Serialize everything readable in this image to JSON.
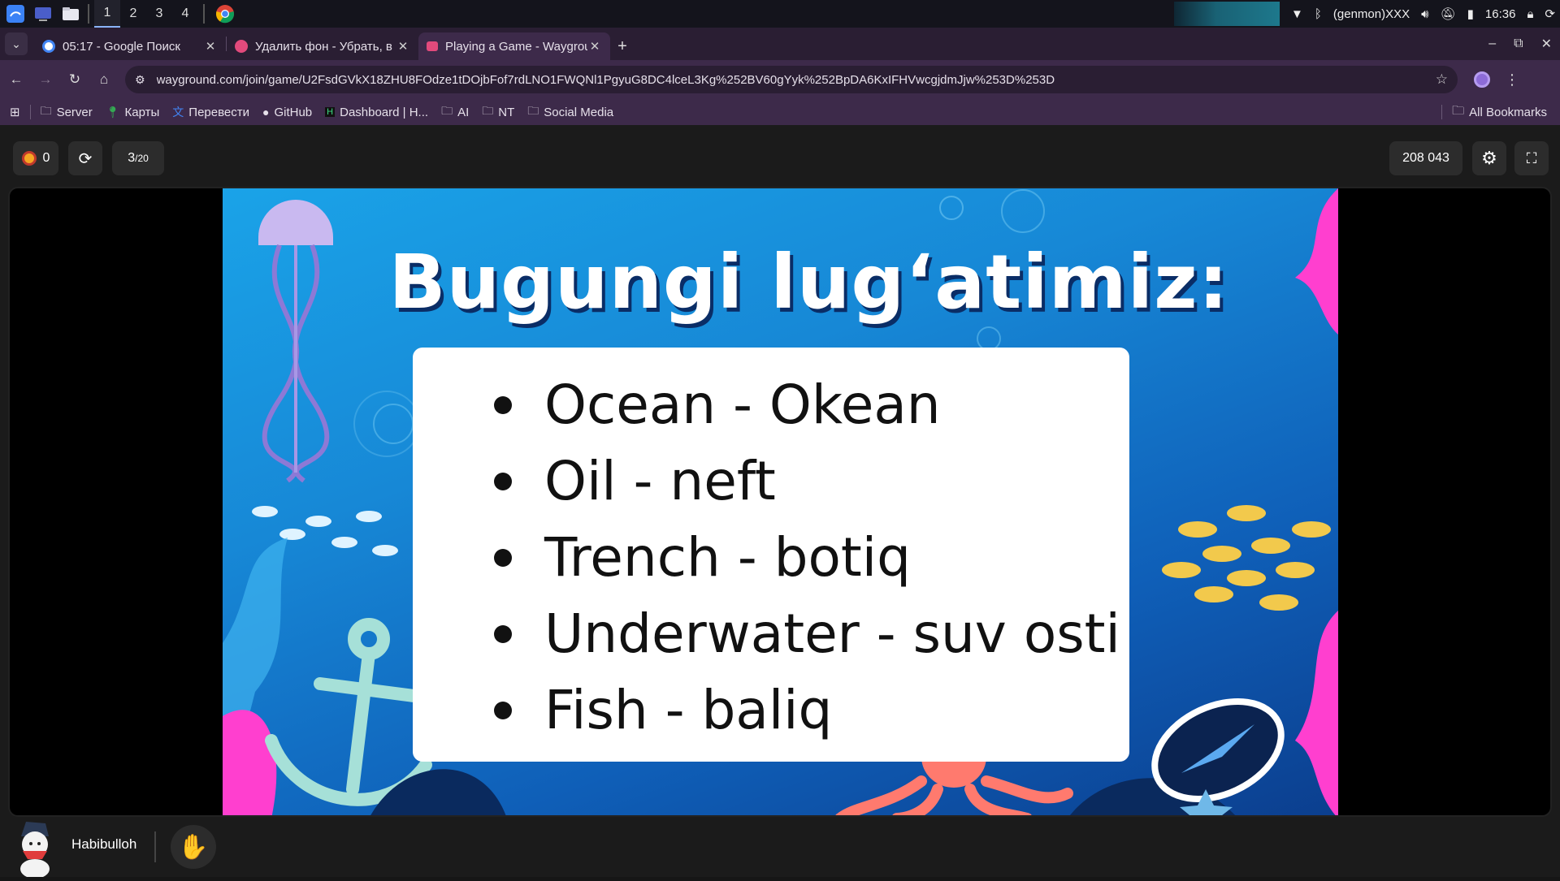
{
  "os_panel": {
    "workspaces": [
      "1",
      "2",
      "3",
      "4"
    ],
    "active_workspace": "1",
    "genmon": "(genmon)XXX",
    "clock": "16:36"
  },
  "tabs": [
    {
      "title": "05:17 - Google Поиск",
      "favicon_color": "#4285f4"
    },
    {
      "title": "Удалить фон - Убрать, в",
      "favicon_color": "#e24a7c"
    },
    {
      "title": "Playing a Game - Wayground",
      "favicon_color": "#e24a7c",
      "active": true
    }
  ],
  "address_bar": {
    "url": "wayground.com/join/game/U2FsdGVkX18ZHU8FOdze1tDOjbFof7rdLNO1FWQNl1PgyuG8DC4lceL3Kg%252BV60gYyk%252BpDA6KxIFHVwcgjdmJjw%253D%253D"
  },
  "bookmarks": [
    {
      "label": "Server",
      "icon": "folder-icon"
    },
    {
      "label": "Карты",
      "icon": "maps-icon"
    },
    {
      "label": "Перевести",
      "icon": "translate-icon"
    },
    {
      "label": "GitHub",
      "icon": "github-icon"
    },
    {
      "label": "Dashboard | H...",
      "icon": "dashboard-icon"
    },
    {
      "label": "AI",
      "icon": "folder-icon"
    },
    {
      "label": "NT",
      "icon": "folder-icon"
    },
    {
      "label": "Social Media",
      "icon": "folder-icon"
    }
  ],
  "all_bookmarks": "All Bookmarks",
  "game": {
    "streak": "0",
    "question_current": "3",
    "question_total": "/20",
    "game_code": "208 043"
  },
  "slide": {
    "title": "Bugungi lug‘atimiz:",
    "items": [
      "Ocean - Okean",
      "Oil - neft",
      "Trench - botiq",
      "Underwater - suv osti",
      "Fish - baliq"
    ]
  },
  "player": {
    "name": "Habibulloh"
  },
  "colors": {
    "accent": "#8ab4f8",
    "tab_bar": "#2a1e33",
    "toolbar": "#3d2a4a",
    "slide_blue": "#1788d6",
    "raise_hand": "#f5a623"
  }
}
